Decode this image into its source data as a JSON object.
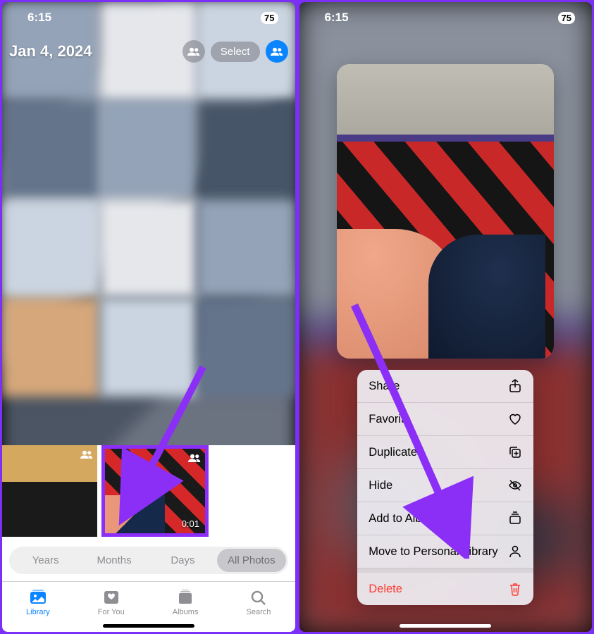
{
  "status": {
    "time": "6:15",
    "battery": "75"
  },
  "left": {
    "date": "Jan 4, 2024",
    "select_label": "Select",
    "thumb_duration": "0:01",
    "segments": {
      "years": "Years",
      "months": "Months",
      "days": "Days",
      "all": "All Photos"
    },
    "tabs": {
      "library": "Library",
      "for_you": "For You",
      "albums": "Albums",
      "search": "Search"
    }
  },
  "right": {
    "menu": {
      "share": "Share",
      "favorite": "Favorite",
      "duplicate": "Duplicate",
      "hide": "Hide",
      "add_to_album": "Add to Album",
      "move_personal": "Move to Personal Library",
      "delete": "Delete"
    }
  }
}
